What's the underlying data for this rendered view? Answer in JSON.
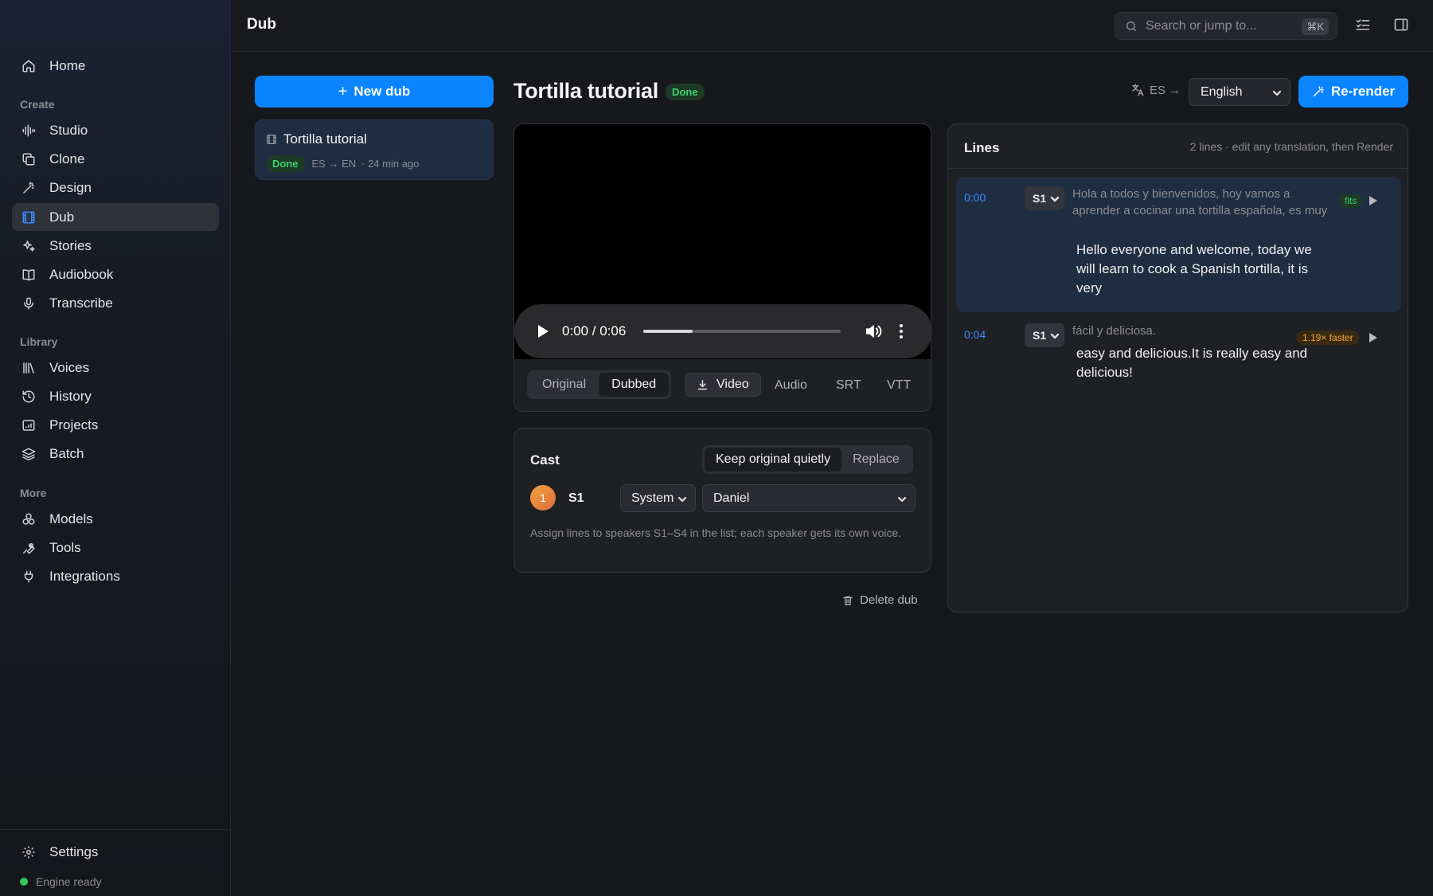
{
  "app": {
    "page_title": "Dub"
  },
  "sidebar": {
    "home": "Home",
    "sections": {
      "create": "Create",
      "library": "Library",
      "more": "More"
    },
    "create_items": [
      "Studio",
      "Clone",
      "Design",
      "Dub",
      "Stories",
      "Audiobook",
      "Transcribe"
    ],
    "library_items": [
      "Voices",
      "History",
      "Projects",
      "Batch"
    ],
    "more_items": [
      "Models",
      "Tools",
      "Integrations"
    ],
    "active_item": "Dub",
    "settings": "Settings",
    "engine_status": "Engine ready",
    "engine_status_color": "#34c759"
  },
  "topbar": {
    "search_placeholder": "Search or jump to...",
    "search_shortcut": "⌘K",
    "icons": [
      "search-icon",
      "checklist-icon",
      "sidebar-toggle-icon"
    ]
  },
  "dub_list": {
    "new_dub_label": "New dub",
    "items": [
      {
        "title": "Tortilla tutorial",
        "status": "Done",
        "route": "ES → EN",
        "age": "· 24 min ago"
      }
    ]
  },
  "detail": {
    "title": "Tortilla tutorial",
    "status": "Done",
    "source_lang": "ES →",
    "target_lang": "English",
    "rerender_label": "Re-render",
    "accent_color": "#0a84ff"
  },
  "player": {
    "time": "0:00 / 0:06",
    "progress_fraction": 0.25,
    "view_options": [
      "Original",
      "Dubbed"
    ],
    "selected_view": "Dubbed",
    "download_video_label": "Video",
    "formats": [
      "Audio",
      "SRT",
      "VTT"
    ]
  },
  "cast": {
    "title": "Cast",
    "mix_options": [
      "Keep original quietly",
      "Replace"
    ],
    "selected_mix": "Keep original quietly",
    "speakers": [
      {
        "number": "1",
        "name": "S1",
        "source": "System",
        "voice": "Daniel"
      }
    ],
    "hint": "Assign lines to speakers S1–S4 in the list; each speaker gets its own voice."
  },
  "delete_label": "Delete dub",
  "lines": {
    "title": "Lines",
    "summary": "2 lines · edit any translation, then Render",
    "items": [
      {
        "time": "0:00",
        "speaker": "S1",
        "source": "Hola a todos y bienvenidos, hoy vamos a aprender a cocinar una tortilla española, es muy",
        "translation": "Hello everyone and welcome, today we will learn to cook a Spanish tortilla, it is very",
        "fit": "fits",
        "active": true
      },
      {
        "time": "0:04",
        "speaker": "S1",
        "source": "fácil y deliciosa.",
        "translation": "easy and delicious.It is really easy and delicious!",
        "fit": "1.19× faster",
        "active": false
      }
    ]
  }
}
